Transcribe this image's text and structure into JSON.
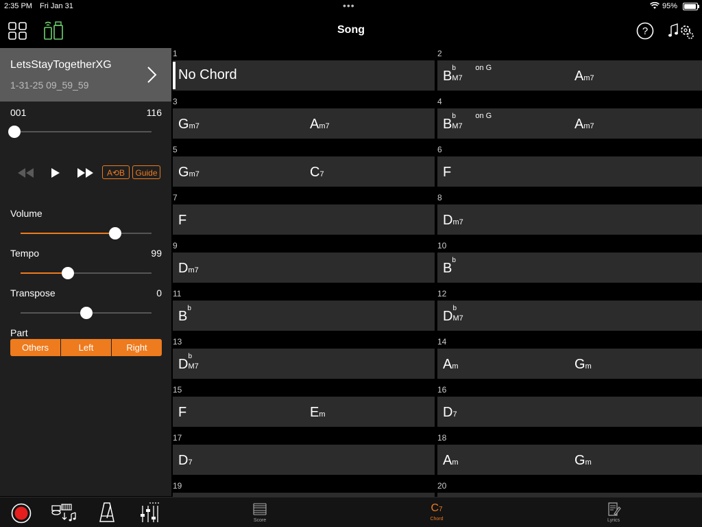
{
  "status_bar": {
    "time": "2:35 PM",
    "date": "Fri Jan 31",
    "battery": "95%"
  },
  "header": {
    "title": "Song"
  },
  "song": {
    "name": "LetsStayTogetherXG",
    "date": "1-31-25 09_59_59"
  },
  "position": {
    "start": "001",
    "end": "116",
    "value": 0.0
  },
  "transport": {
    "ab_label": "A⟲B",
    "guide_label": "Guide"
  },
  "volume": {
    "label": "Volume",
    "value": 0.72
  },
  "tempo": {
    "label": "Tempo",
    "value_text": "99",
    "value": 0.36
  },
  "transpose": {
    "label": "Transpose",
    "value_text": "0",
    "value": 0.5
  },
  "part": {
    "label": "Part",
    "options": [
      "Others",
      "Left",
      "Right"
    ]
  },
  "tabs": [
    {
      "label": "Score",
      "active": false
    },
    {
      "label": "Chord",
      "active": true
    },
    {
      "label": "Lyrics",
      "active": false
    }
  ],
  "colors": {
    "accent": "#ee7b1e",
    "record": "#e61e1e"
  },
  "bars": [
    {
      "num": "1",
      "chords": [
        {
          "root": "No Chord",
          "acc": "",
          "qual": "",
          "on": ""
        }
      ]
    },
    {
      "num": "2",
      "chords": [
        {
          "root": "B",
          "acc": "b",
          "qual": "M7",
          "on": "on G"
        },
        {
          "root": "A",
          "acc": "",
          "qual": "m7",
          "on": ""
        }
      ]
    },
    {
      "num": "3",
      "chords": [
        {
          "root": "G",
          "acc": "",
          "qual": "m7",
          "on": ""
        },
        {
          "root": "A",
          "acc": "",
          "qual": "m7",
          "on": ""
        }
      ]
    },
    {
      "num": "4",
      "chords": [
        {
          "root": "B",
          "acc": "b",
          "qual": "M7",
          "on": "on G"
        },
        {
          "root": "A",
          "acc": "",
          "qual": "m7",
          "on": ""
        }
      ]
    },
    {
      "num": "5",
      "chords": [
        {
          "root": "G",
          "acc": "",
          "qual": "m7",
          "on": ""
        },
        {
          "root": "C",
          "acc": "",
          "qual": "7",
          "on": ""
        }
      ]
    },
    {
      "num": "6",
      "chords": [
        {
          "root": "F",
          "acc": "",
          "qual": "",
          "on": ""
        }
      ]
    },
    {
      "num": "7",
      "chords": [
        {
          "root": "F",
          "acc": "",
          "qual": "",
          "on": ""
        }
      ]
    },
    {
      "num": "8",
      "chords": [
        {
          "root": "D",
          "acc": "",
          "qual": "m7",
          "on": ""
        }
      ]
    },
    {
      "num": "9",
      "chords": [
        {
          "root": "D",
          "acc": "",
          "qual": "m7",
          "on": ""
        }
      ]
    },
    {
      "num": "10",
      "chords": [
        {
          "root": "B",
          "acc": "b",
          "qual": "",
          "on": ""
        }
      ]
    },
    {
      "num": "11",
      "chords": [
        {
          "root": "B",
          "acc": "b",
          "qual": "",
          "on": ""
        }
      ]
    },
    {
      "num": "12",
      "chords": [
        {
          "root": "D",
          "acc": "b",
          "qual": "M7",
          "on": ""
        }
      ]
    },
    {
      "num": "13",
      "chords": [
        {
          "root": "D",
          "acc": "b",
          "qual": "M7",
          "on": ""
        }
      ]
    },
    {
      "num": "14",
      "chords": [
        {
          "root": "A",
          "acc": "",
          "qual": "m",
          "on": ""
        },
        {
          "root": "G",
          "acc": "",
          "qual": "m",
          "on": ""
        }
      ]
    },
    {
      "num": "15",
      "chords": [
        {
          "root": "F",
          "acc": "",
          "qual": "",
          "on": ""
        },
        {
          "root": "E",
          "acc": "",
          "qual": "m",
          "on": ""
        }
      ]
    },
    {
      "num": "16",
      "chords": [
        {
          "root": "D",
          "acc": "",
          "qual": "7",
          "on": ""
        }
      ]
    },
    {
      "num": "17",
      "chords": [
        {
          "root": "D",
          "acc": "",
          "qual": "7",
          "on": ""
        }
      ]
    },
    {
      "num": "18",
      "chords": [
        {
          "root": "A",
          "acc": "",
          "qual": "m",
          "on": ""
        },
        {
          "root": "G",
          "acc": "",
          "qual": "m",
          "on": ""
        }
      ]
    },
    {
      "num": "19",
      "chords": []
    },
    {
      "num": "20",
      "chords": []
    }
  ]
}
